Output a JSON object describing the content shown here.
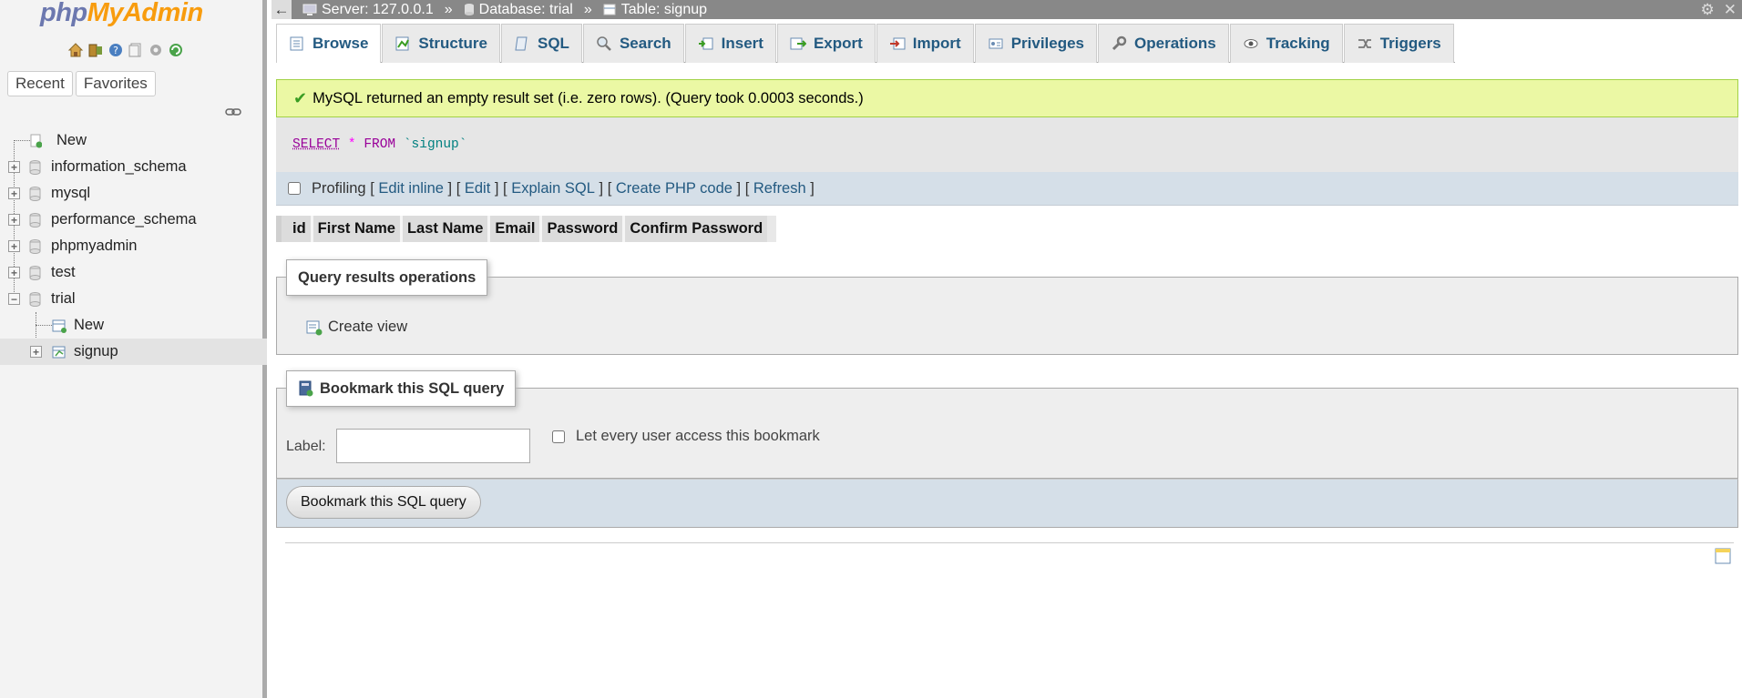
{
  "app": {
    "logo_php": "php",
    "logo_ma": "MyAdmin"
  },
  "sidebar": {
    "tabs": [
      "Recent",
      "Favorites"
    ],
    "tree": [
      {
        "label": "New",
        "type": "new"
      },
      {
        "label": "information_schema",
        "type": "db"
      },
      {
        "label": "mysql",
        "type": "db"
      },
      {
        "label": "performance_schema",
        "type": "db"
      },
      {
        "label": "phpmyadmin",
        "type": "db"
      },
      {
        "label": "test",
        "type": "db"
      },
      {
        "label": "trial",
        "type": "db-open"
      },
      {
        "label": "New",
        "type": "new-child"
      },
      {
        "label": "signup",
        "type": "table"
      }
    ]
  },
  "breadcrumb": {
    "server": "Server: 127.0.0.1",
    "database": "Database: trial",
    "table": "Table: signup",
    "separator": "»",
    "back": "←"
  },
  "tabs": [
    {
      "label": "Browse",
      "icon": "browse-icon",
      "active": true
    },
    {
      "label": "Structure",
      "icon": "structure-icon"
    },
    {
      "label": "SQL",
      "icon": "sql-icon"
    },
    {
      "label": "Search",
      "icon": "search-icon"
    },
    {
      "label": "Insert",
      "icon": "insert-icon"
    },
    {
      "label": "Export",
      "icon": "export-icon"
    },
    {
      "label": "Import",
      "icon": "import-icon"
    },
    {
      "label": "Privileges",
      "icon": "privileges-icon"
    },
    {
      "label": "Operations",
      "icon": "operations-icon"
    },
    {
      "label": "Tracking",
      "icon": "tracking-icon"
    },
    {
      "label": "Triggers",
      "icon": "triggers-icon"
    }
  ],
  "message": "MySQL returned an empty result set (i.e. zero rows). (Query took 0.0003 seconds.)",
  "sql": {
    "select": "SELECT",
    "star": "*",
    "from": "FROM",
    "table": "`signup`"
  },
  "profiling": {
    "label": "Profiling",
    "links": [
      "Edit inline",
      "Edit",
      "Explain SQL",
      "Create PHP code",
      "Refresh"
    ]
  },
  "columns": [
    "id",
    "First Name",
    "Last Name",
    "Email",
    "Password",
    "Confirm Password"
  ],
  "ops": {
    "legend": "Query results operations",
    "create_view": "Create view"
  },
  "bookmark": {
    "legend": "Bookmark this SQL query",
    "label": "Label:",
    "check_label": "Let every user access this bookmark",
    "button": "Bookmark this SQL query",
    "input_value": ""
  },
  "colors": {
    "accent": "#235a81",
    "success_bg": "#ebf8a4",
    "sidebar_bg": "#f3f3f3"
  }
}
